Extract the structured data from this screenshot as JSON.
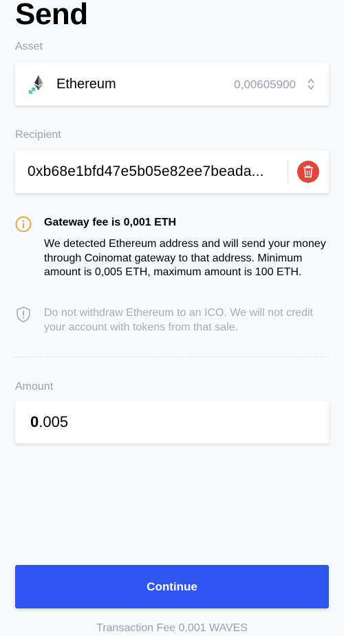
{
  "header": {
    "title": "Send"
  },
  "asset": {
    "label": "Asset",
    "name": "Ethereum",
    "balance": "0,00605900",
    "icon": "ethereum-icon"
  },
  "recipient": {
    "label": "Recipient",
    "address": "0xb68e1bfd47e5b05e82ee7beada..."
  },
  "gateway_notice": {
    "title": "Gateway fee is 0,001 ETH",
    "body": "We detected Ethereum address and will send your money through Coinomat gateway to that address. Minimum amount is 0,005 ETH, maximum amount is 100 ETH."
  },
  "warning_notice": {
    "body": "Do not withdraw Ethereum to an ICO. We will not credit your account with tokens from that sale."
  },
  "amount": {
    "label": "Amount",
    "integer_part": "0",
    "fraction_part": ".005"
  },
  "actions": {
    "continue_label": "Continue"
  },
  "footer": {
    "fee": "Transaction Fee 0,001 WAVES"
  },
  "colors": {
    "accent": "#2f56f0",
    "delete": "#e0443b",
    "info": "#e79a2b",
    "muted": "#9aa1ad",
    "teal": "#31c3c0"
  }
}
